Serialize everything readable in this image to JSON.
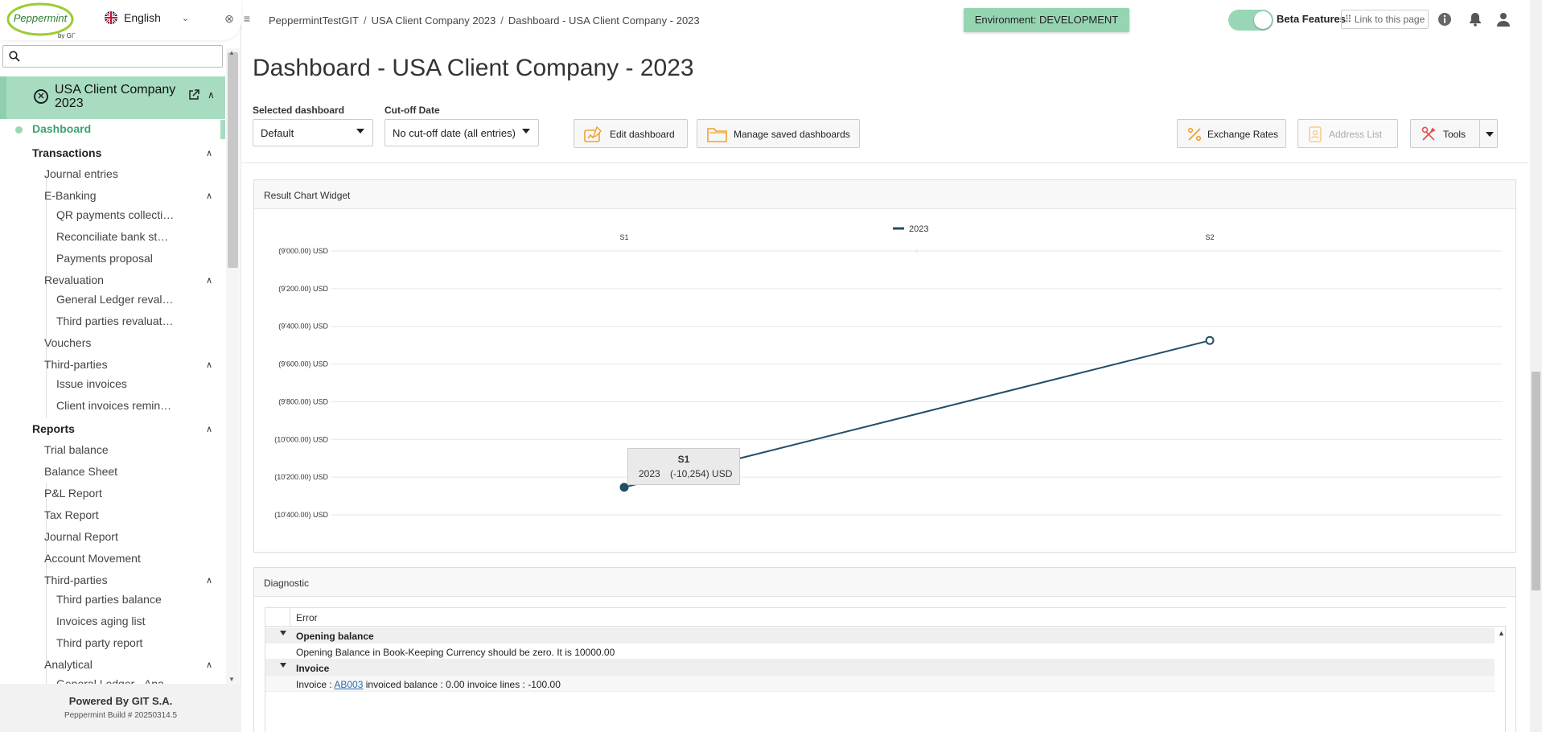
{
  "sidebar": {
    "logo_text": "Peppermint",
    "logo_sub": "by GIT",
    "language": "English",
    "search_placeholder": "",
    "company_name": "USA Client Company 2023",
    "active_item": "Dashboard",
    "sections": {
      "transactions": "Transactions",
      "journal_entries": "Journal entries",
      "ebanking": "E-Banking",
      "qr_payments": "QR payments collecti…",
      "reconcile": "Reconciliate bank st…",
      "payments_proposal": "Payments proposal",
      "revaluation": "Revaluation",
      "gl_reval": "General Ledger reval…",
      "tp_reval": "Third parties revaluat…",
      "vouchers": "Vouchers",
      "third_parties": "Third-parties",
      "issue_invoices": "Issue invoices",
      "client_invoices": "Client invoices remin…",
      "reports": "Reports",
      "trial_balance": "Trial balance",
      "balance_sheet": "Balance Sheet",
      "pl_report": "P&L Report",
      "tax_report": "Tax Report",
      "journal_report": "Journal Report",
      "account_movement": "Account Movement",
      "third_parties_r": "Third-parties",
      "tp_balance": "Third parties balance",
      "aging_list": "Invoices aging list",
      "tp_report": "Third party report",
      "analytical": "Analytical",
      "gl_ana": "General Ledger - Ana…"
    },
    "footer_powered": "Powered By GIT S.A.",
    "footer_build": "Peppermint Build # 20250314.5"
  },
  "header": {
    "breadcrumb": [
      "PeppermintTestGIT",
      "USA Client Company 2023",
      "Dashboard - USA Client Company - 2023"
    ],
    "breadcrumb_sep": "/",
    "environment": "Environment: DEVELOPMENT",
    "beta_label": "Beta Features",
    "beta_on": true,
    "link_label": "⠿ Link to this page"
  },
  "main": {
    "title": "Dashboard - USA Client Company - 2023",
    "selected_dashboard_label": "Selected dashboard",
    "selected_dashboard_value": "Default",
    "cutoff_label": "Cut-off Date",
    "cutoff_value": "No cut-off date (all entries)",
    "edit_dashboard": "Edit dashboard",
    "manage_dashboards": "Manage saved dashboards",
    "exchange_rates": "Exchange Rates",
    "address_list": "Address List",
    "tools": "Tools"
  },
  "result_widget": {
    "title": "Result Chart Widget",
    "tooltip": {
      "category": "S1",
      "series": "2023",
      "value": "(-10,254) USD"
    }
  },
  "chart_data": {
    "type": "line",
    "categories": [
      "S1",
      "S2"
    ],
    "series": [
      {
        "name": "2023",
        "values": [
          -10254,
          -9475
        ],
        "color": "#1f4e66"
      }
    ],
    "y_ticks": [
      "(9'000.00) USD",
      "(9'200.00) USD",
      "(9'400.00) USD",
      "(9'600.00) USD",
      "(9'800.00) USD",
      "(10'000.00) USD",
      "(10'200.00) USD",
      "(10'400.00) USD"
    ],
    "y_tick_values": [
      -9000,
      -9200,
      -9400,
      -9600,
      -9800,
      -10000,
      -10200,
      -10400
    ],
    "ylim": [
      -10400,
      -9000
    ],
    "legend_position": "top-center",
    "x_axis_position": "top",
    "grid": true
  },
  "diagnostic": {
    "title": "Diagnostic",
    "column": "Error",
    "groups": [
      {
        "label": "Opening balance",
        "rows": [
          {
            "text": "Opening Balance in Book-Keeping Currency should be zero. It is 10000.00"
          }
        ]
      },
      {
        "label": "Invoice",
        "rows": [
          {
            "prefix": "Invoice : ",
            "link": "AB003",
            "suffix": " invoiced balance : 0.00 invoice lines : -100.00"
          }
        ]
      }
    ]
  },
  "colors": {
    "accent": "#a8dcc1",
    "env_badge": "#96d5b2",
    "line": "#1f4e66"
  }
}
